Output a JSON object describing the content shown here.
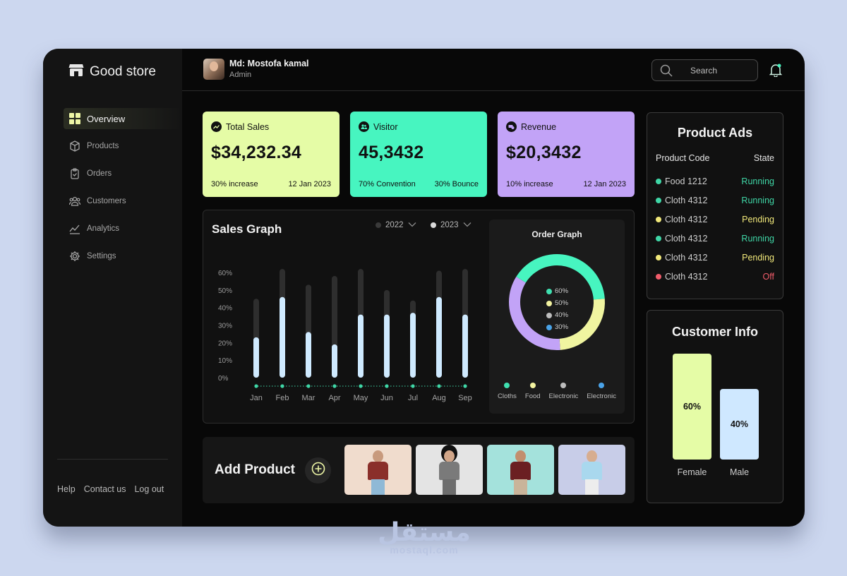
{
  "brand": {
    "name": "Good store",
    "icon": "store-icon"
  },
  "user": {
    "name": "Md: Mostofa kamal",
    "role": "Admin"
  },
  "search": {
    "placeholder": "Search"
  },
  "sidebar": {
    "items": [
      {
        "label": "Overview",
        "icon": "grid-icon"
      },
      {
        "label": "Products",
        "icon": "box-icon"
      },
      {
        "label": "Orders",
        "icon": "clipboard-icon"
      },
      {
        "label": "Customers",
        "icon": "users-icon"
      },
      {
        "label": "Analytics",
        "icon": "chart-line-icon"
      },
      {
        "label": "Settings",
        "icon": "gear-icon"
      }
    ],
    "footer": [
      "Help",
      "Contact us",
      "Log out"
    ]
  },
  "stats": [
    {
      "title": "Total Sales",
      "value": "$34,232.34",
      "left": "30% increase",
      "right": "12 Jan 2023",
      "color": "#e5fca6"
    },
    {
      "title": "Visitor",
      "value": "45,3432",
      "left": "70% Convention",
      "right": "30% Bounce",
      "color": "#47f5c0"
    },
    {
      "title": "Revenue",
      "value": "$20,3432",
      "left": "10% increase",
      "right": "12 Jan 2023",
      "color": "#c2a3f7"
    }
  ],
  "sales_graph": {
    "title": "Sales Graph",
    "legend": [
      {
        "label": "2022",
        "color": "#3a3a3a"
      },
      {
        "label": "2023",
        "color": "#d9d9d9"
      }
    ]
  },
  "order_graph": {
    "title": "Order Graph",
    "legend": [
      {
        "label": "60%",
        "color": "#3fe0b0"
      },
      {
        "label": "50%",
        "color": "#f3f3a0"
      },
      {
        "label": "40%",
        "color": "#bdbdbd"
      },
      {
        "label": "30%",
        "color": "#4aa3e8"
      }
    ],
    "categories": [
      {
        "label": "Cloths",
        "color": "#3fe0b0"
      },
      {
        "label": "Food",
        "color": "#f3f3a0"
      },
      {
        "label": "Electronic",
        "color": "#bdbdbd"
      },
      {
        "label": "Electronic",
        "color": "#4aa3e8"
      }
    ]
  },
  "chart_data": [
    {
      "type": "bar",
      "title": "Sales Graph",
      "categories": [
        "Jan",
        "Feb",
        "Mar",
        "Apr",
        "May",
        "Jun",
        "Jul",
        "Aug",
        "Sep"
      ],
      "yticks": [
        "0%",
        "10%",
        "20%",
        "30%",
        "40%",
        "50%",
        "60%"
      ],
      "ylim": [
        0,
        60
      ],
      "series": [
        {
          "name": "2022",
          "values": [
            45,
            62,
            53,
            58,
            62,
            50,
            44,
            61,
            62
          ],
          "color": "#2e2e2e"
        },
        {
          "name": "2023",
          "values": [
            23,
            46,
            26,
            19,
            36,
            36,
            37,
            46,
            36
          ],
          "color": "#cfeaff"
        }
      ]
    },
    {
      "type": "pie",
      "title": "Order Graph",
      "donut": true,
      "labels": [
        "Cloths",
        "Food",
        "Electronic"
      ],
      "values": [
        40,
        25,
        35
      ],
      "colors": [
        "#47f5c0",
        "#f0f5a0",
        "#c2a3f7"
      ]
    }
  ],
  "add_product": {
    "title": "Add Product"
  },
  "product_ads": {
    "title": "Product Ads",
    "col_code": "Product Code",
    "col_state": "State",
    "rows": [
      {
        "code": "Food 1212",
        "state": "Running",
        "dot": "#3fd6a6",
        "color": "#3fd6a6"
      },
      {
        "code": "Cloth 4312",
        "state": "Running",
        "dot": "#3fd6a6",
        "color": "#3fd6a6"
      },
      {
        "code": "Cloth 4312",
        "state": "Pending",
        "dot": "#f1e87a",
        "color": "#f1e87a"
      },
      {
        "code": "Cloth 4312",
        "state": "Running",
        "dot": "#3fd6a6",
        "color": "#3fd6a6"
      },
      {
        "code": "Cloth 4312",
        "state": "Pending",
        "dot": "#f1e87a",
        "color": "#f1e87a"
      },
      {
        "code": "Cloth 4312",
        "state": "Off",
        "dot": "#f05c6a",
        "color": "#f05c6a"
      }
    ]
  },
  "customer_info": {
    "title": "Customer Info",
    "bars": [
      {
        "label": "Female",
        "value": "60%",
        "fraction": 0.6,
        "color": "#e5fca6"
      },
      {
        "label": "Male",
        "value": "40%",
        "fraction": 0.4,
        "color": "#cfe8ff"
      }
    ]
  },
  "watermark": {
    "ar": "مستقل",
    "en": "mostaql.com"
  }
}
